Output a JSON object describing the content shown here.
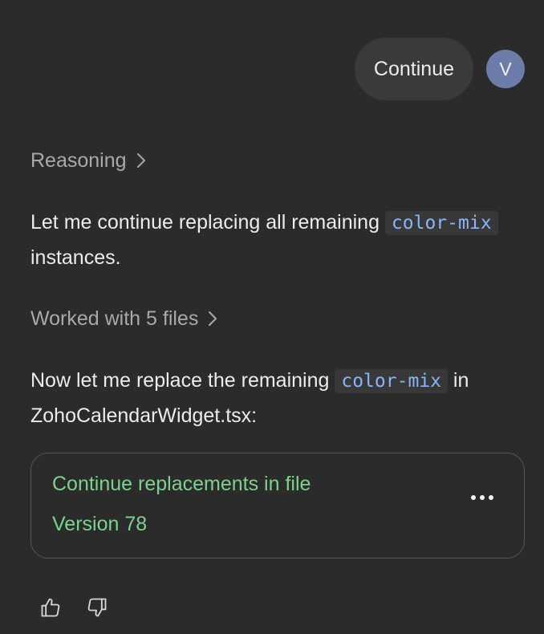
{
  "user_message": {
    "text": "Continue",
    "avatar_initial": "V",
    "avatar_color": "#6b7da8"
  },
  "assistant": {
    "reasoning_label": "Reasoning",
    "paragraph1": {
      "before": "Let me continue replacing all remaining ",
      "code": "color-mix",
      "after": " instances."
    },
    "worked_label": "Worked with 5 files",
    "paragraph2": {
      "before": "Now let me replace the remaining ",
      "code": "color-mix",
      "after": " in ZohoCalendarWidget.tsx:"
    },
    "card": {
      "title": "Continue replacements in file",
      "subtitle": "Version 78",
      "accent": "#7cd28c",
      "menu_icon": "more-horizontal-icon"
    },
    "feedback": {
      "like_icon": "thumbs-up-icon",
      "dislike_icon": "thumbs-down-icon"
    }
  }
}
